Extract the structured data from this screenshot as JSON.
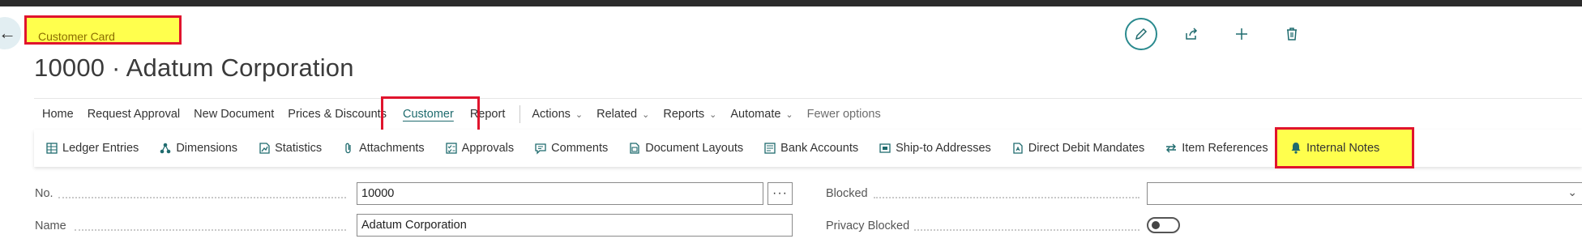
{
  "header": {
    "breadcrumb_label": "Customer Card",
    "page_title": "10000 · Adatum Corporation"
  },
  "top_actions": [
    {
      "name": "edit-icon"
    },
    {
      "name": "share-icon"
    },
    {
      "name": "new-icon"
    },
    {
      "name": "delete-icon"
    }
  ],
  "menu": {
    "items": [
      "Home",
      "Request Approval",
      "New Document",
      "Prices & Discounts",
      "Customer",
      "Report"
    ],
    "dropdowns": [
      "Actions",
      "Related",
      "Reports",
      "Automate"
    ],
    "fewer_options": "Fewer options"
  },
  "promoted": {
    "items": [
      {
        "label": "Ledger Entries",
        "icon": "ledger-entries-icon"
      },
      {
        "label": "Dimensions",
        "icon": "dimensions-icon"
      },
      {
        "label": "Statistics",
        "icon": "statistics-icon"
      },
      {
        "label": "Attachments",
        "icon": "attachments-icon"
      },
      {
        "label": "Approvals",
        "icon": "approvals-icon"
      },
      {
        "label": "Comments",
        "icon": "comments-icon"
      },
      {
        "label": "Document Layouts",
        "icon": "document-layouts-icon"
      },
      {
        "label": "Bank Accounts",
        "icon": "bank-accounts-icon"
      },
      {
        "label": "Ship-to Addresses",
        "icon": "ship-to-addresses-icon"
      },
      {
        "label": "Direct Debit Mandates",
        "icon": "direct-debit-mandates-icon"
      },
      {
        "label": "Item References",
        "icon": "item-references-icon"
      }
    ],
    "internal_notes": "Internal Notes"
  },
  "fields": {
    "no_label": "No.",
    "no_value": "10000",
    "assist_label": "···",
    "name_label": "Name",
    "name_value": "Adatum Corporation",
    "blocked_label": "Blocked",
    "blocked_value": "",
    "privacy_blocked_label": "Privacy Blocked",
    "privacy_blocked_value": false
  },
  "colors": {
    "highlight": "#ffff4d",
    "highlight_border": "#e0142d",
    "accent": "#1f6b6e"
  }
}
